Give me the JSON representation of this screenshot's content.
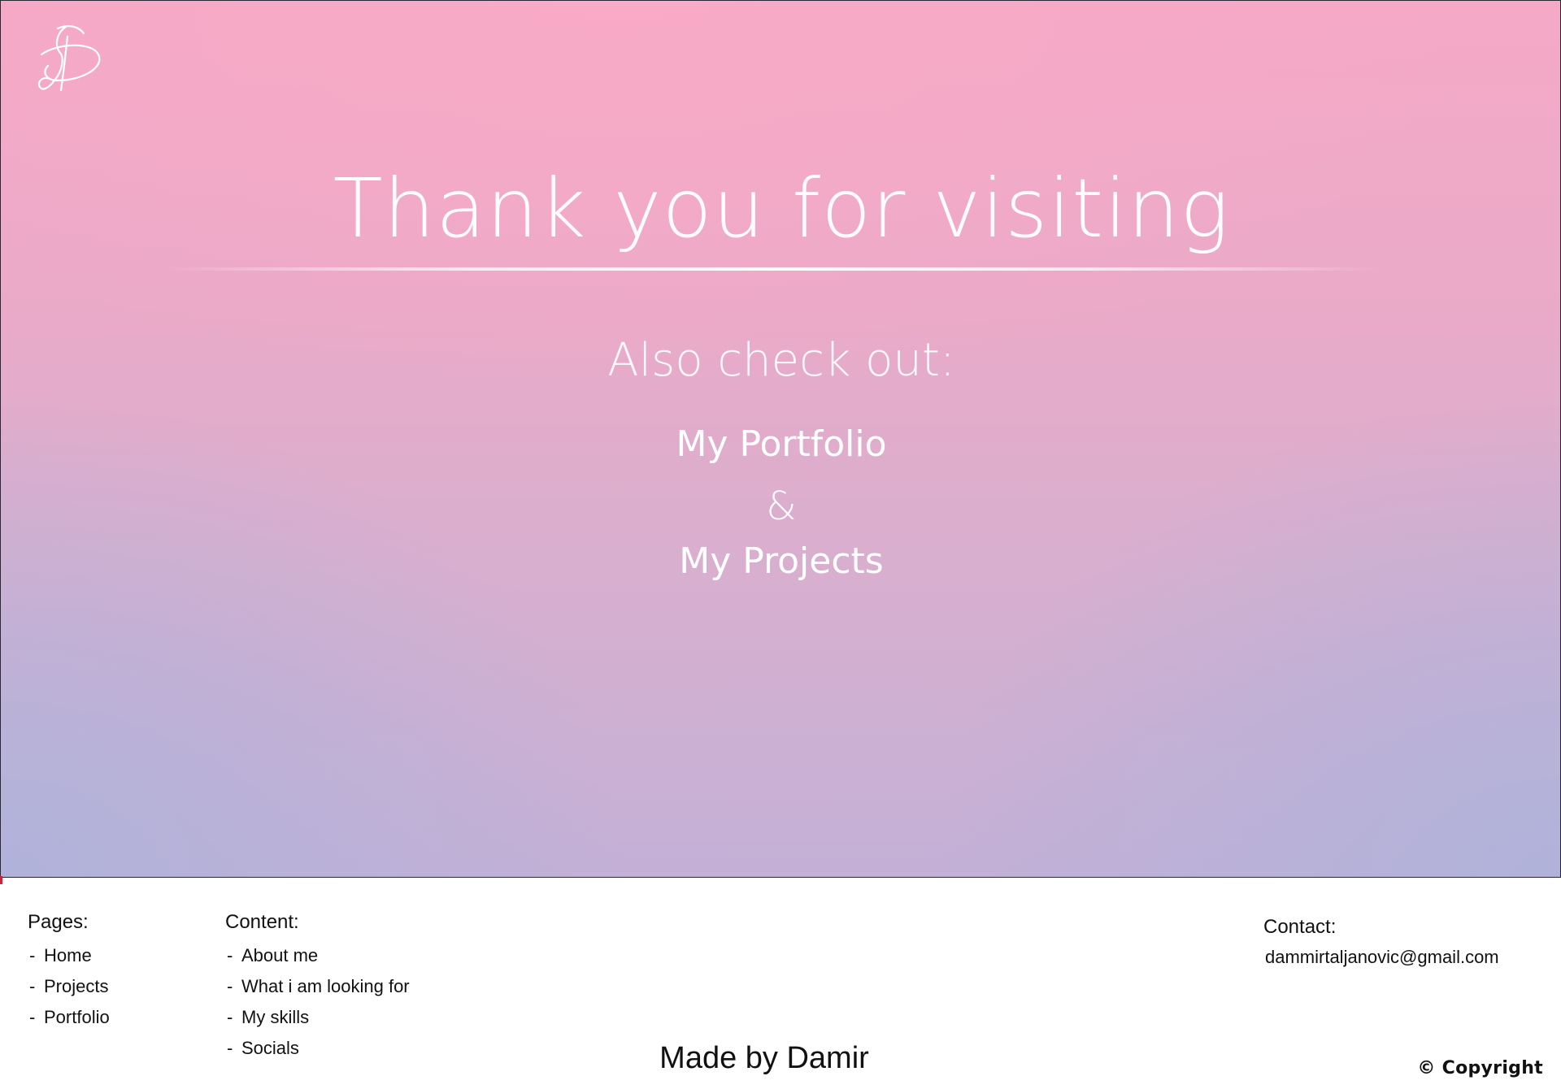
{
  "hero": {
    "logo": "script-letter-d-logo",
    "title": "Thank you for visiting",
    "subtitle": "Also check out:",
    "links": [
      {
        "label": "My Portfolio"
      },
      {
        "label": "My Projects"
      }
    ],
    "ampersand": "&",
    "colors": {
      "top_pink": "#f5a9c6",
      "bottom_lavender": "#b0b2da",
      "text": "#ffffff"
    }
  },
  "footer": {
    "pages": {
      "title": "Pages:",
      "items": [
        "Home",
        "Projects",
        "Portfolio"
      ]
    },
    "content": {
      "title": "Content:",
      "items": [
        "About me",
        "What i am looking for",
        "My skills",
        "Socials"
      ]
    },
    "contact": {
      "title": "Contact:",
      "email": "dammirtaljanovic@gmail.com"
    },
    "made_by": "Made by Damir",
    "copyright": "© Copyright"
  }
}
